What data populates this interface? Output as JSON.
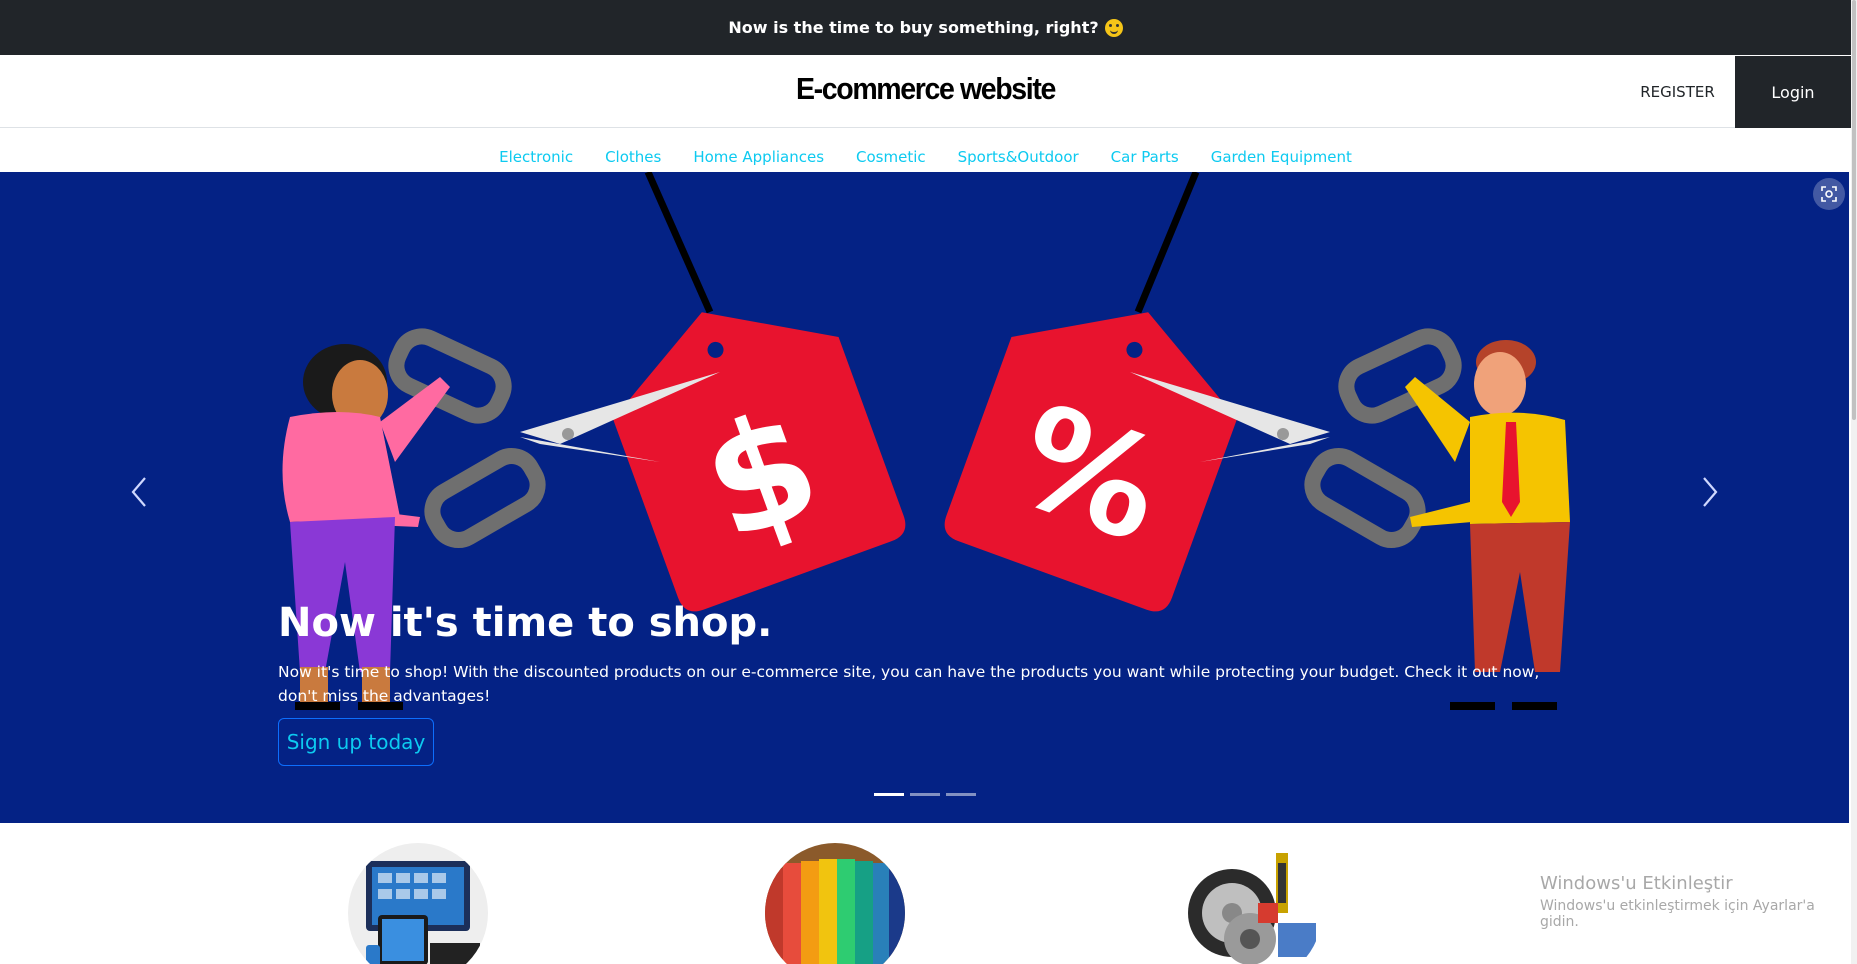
{
  "top_banner": {
    "text": "Now is the time to buy something, right?",
    "emoji_icon": "smirk-emoji-icon"
  },
  "header": {
    "logo": "E-commerce website",
    "register_label": "REGISTER",
    "login_label": "Login"
  },
  "categories": [
    "Electronic",
    "Clothes",
    "Home Appliances",
    "Cosmetic",
    "Sports&Outdoor",
    "Car Parts",
    "Garden Equipment"
  ],
  "carousel": {
    "title": "Now it's time to shop.",
    "description": "Now it's time to shop! With the discounted products on our e-commerce site, you can have the products you want while protecting your budget. Check it out now, don't miss the advantages!",
    "cta_label": "Sign up today",
    "background_color": "#042285",
    "active_slide": 1,
    "slide_count": 3
  },
  "category_images": [
    "electronics-image",
    "clothes-image",
    "car-parts-image"
  ],
  "os_watermark": {
    "title": "Windows'u Etkinleştir",
    "subtitle": "Windows'u etkinleştirmek için Ayarlar'a gidin."
  },
  "colors": {
    "banner": "#212529",
    "nav_link": "#0dcaf0",
    "carousel_bg": "#042285",
    "tag_red": "#e8132e"
  }
}
